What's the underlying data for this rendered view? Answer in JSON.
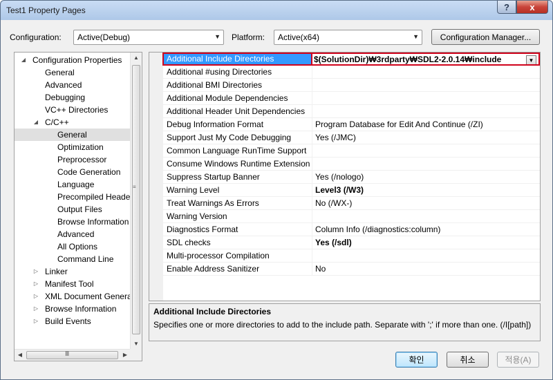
{
  "window": {
    "title": "Test1 Property Pages",
    "help_glyph": "?",
    "close_glyph": "x"
  },
  "toolbar": {
    "configuration_label": "Configuration:",
    "configuration_value": "Active(Debug)",
    "platform_label": "Platform:",
    "platform_value": "Active(x64)",
    "config_manager_label": "Configuration Manager..."
  },
  "tree": {
    "items": [
      {
        "label": "Configuration Properties",
        "level": 0,
        "expander": "expanded",
        "selected": false
      },
      {
        "label": "General",
        "level": 1,
        "expander": "",
        "selected": false
      },
      {
        "label": "Advanced",
        "level": 1,
        "expander": "",
        "selected": false
      },
      {
        "label": "Debugging",
        "level": 1,
        "expander": "",
        "selected": false
      },
      {
        "label": "VC++ Directories",
        "level": 1,
        "expander": "",
        "selected": false
      },
      {
        "label": "C/C++",
        "level": 1,
        "expander": "expanded",
        "selected": false
      },
      {
        "label": "General",
        "level": 2,
        "expander": "",
        "selected": true
      },
      {
        "label": "Optimization",
        "level": 2,
        "expander": "",
        "selected": false
      },
      {
        "label": "Preprocessor",
        "level": 2,
        "expander": "",
        "selected": false
      },
      {
        "label": "Code Generation",
        "level": 2,
        "expander": "",
        "selected": false
      },
      {
        "label": "Language",
        "level": 2,
        "expander": "",
        "selected": false
      },
      {
        "label": "Precompiled Heade",
        "level": 2,
        "expander": "",
        "selected": false
      },
      {
        "label": "Output Files",
        "level": 2,
        "expander": "",
        "selected": false
      },
      {
        "label": "Browse Information",
        "level": 2,
        "expander": "",
        "selected": false
      },
      {
        "label": "Advanced",
        "level": 2,
        "expander": "",
        "selected": false
      },
      {
        "label": "All Options",
        "level": 2,
        "expander": "",
        "selected": false
      },
      {
        "label": "Command Line",
        "level": 2,
        "expander": "",
        "selected": false
      },
      {
        "label": "Linker",
        "level": 1,
        "expander": "collapsed",
        "selected": false
      },
      {
        "label": "Manifest Tool",
        "level": 1,
        "expander": "collapsed",
        "selected": false
      },
      {
        "label": "XML Document Genera",
        "level": 1,
        "expander": "collapsed",
        "selected": false
      },
      {
        "label": "Browse Information",
        "level": 1,
        "expander": "collapsed",
        "selected": false
      },
      {
        "label": "Build Events",
        "level": 1,
        "expander": "collapsed",
        "selected": false
      }
    ],
    "hscroll_grip": "III"
  },
  "grid": {
    "rows": [
      {
        "name": "Additional Include Directories",
        "value": "$(SolutionDir)₩3rdparty₩SDL2-2.0.14₩include",
        "bold": true,
        "selected": true
      },
      {
        "name": "Additional #using Directories",
        "value": "",
        "bold": false,
        "selected": false
      },
      {
        "name": "Additional BMI Directories",
        "value": "",
        "bold": false,
        "selected": false
      },
      {
        "name": "Additional Module Dependencies",
        "value": "",
        "bold": false,
        "selected": false
      },
      {
        "name": "Additional Header Unit Dependencies",
        "value": "",
        "bold": false,
        "selected": false
      },
      {
        "name": "Debug Information Format",
        "value": "Program Database for Edit And Continue (/ZI)",
        "bold": false,
        "selected": false
      },
      {
        "name": "Support Just My Code Debugging",
        "value": "Yes (/JMC)",
        "bold": false,
        "selected": false
      },
      {
        "name": "Common Language RunTime Support",
        "value": "",
        "bold": false,
        "selected": false
      },
      {
        "name": "Consume Windows Runtime Extension",
        "value": "",
        "bold": false,
        "selected": false
      },
      {
        "name": "Suppress Startup Banner",
        "value": "Yes (/nologo)",
        "bold": false,
        "selected": false
      },
      {
        "name": "Warning Level",
        "value": "Level3 (/W3)",
        "bold": true,
        "selected": false
      },
      {
        "name": "Treat Warnings As Errors",
        "value": "No (/WX-)",
        "bold": false,
        "selected": false
      },
      {
        "name": "Warning Version",
        "value": "",
        "bold": false,
        "selected": false
      },
      {
        "name": "Diagnostics Format",
        "value": "Column Info (/diagnostics:column)",
        "bold": false,
        "selected": false
      },
      {
        "name": "SDL checks",
        "value": "Yes (/sdl)",
        "bold": true,
        "selected": false
      },
      {
        "name": "Multi-processor Compilation",
        "value": "",
        "bold": false,
        "selected": false
      },
      {
        "name": "Enable Address Sanitizer",
        "value": "No",
        "bold": false,
        "selected": false
      }
    ]
  },
  "description": {
    "title": "Additional Include Directories",
    "text": "Specifies one or more directories to add to the include path. Separate with ';' if more than one. (/I[path])"
  },
  "buttons": {
    "ok": "확인",
    "cancel": "취소",
    "apply": "적용(A)"
  },
  "colors": {
    "selection_blue": "#3399ff",
    "highlight_red": "#d0021b"
  }
}
